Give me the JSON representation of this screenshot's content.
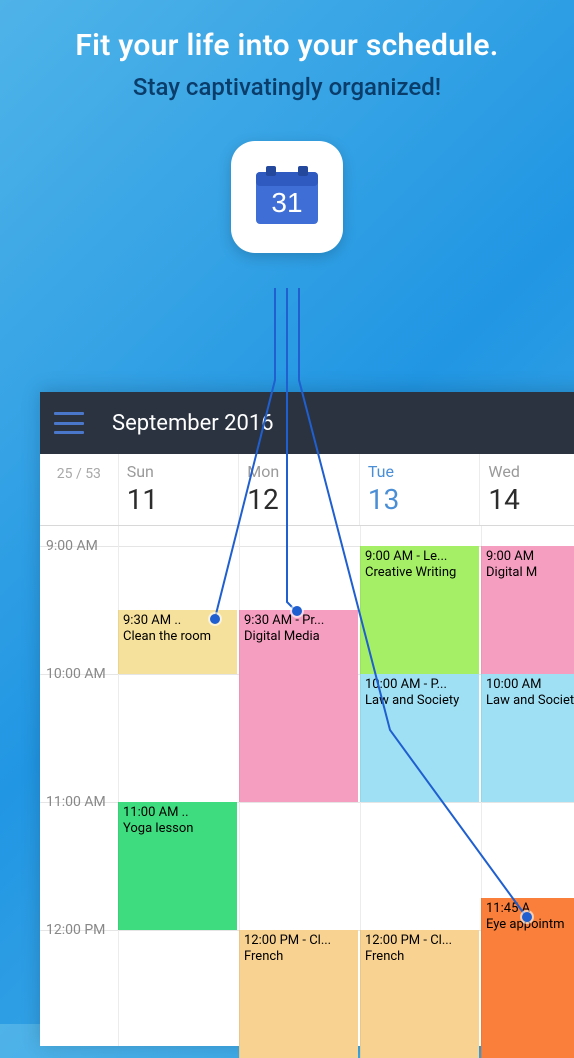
{
  "hero": {
    "title": "Fit your life into your schedule.",
    "subtitle": "Stay captivatingly organized!"
  },
  "app_icon": {
    "day_number": "31"
  },
  "calendar": {
    "header": {
      "title": "September 2016"
    },
    "week_label": "25 / 53",
    "days": [
      {
        "name": "Sun",
        "num": "11"
      },
      {
        "name": "Mon",
        "num": "12"
      },
      {
        "name": "Tue",
        "num": "13"
      },
      {
        "name": "Wed",
        "num": "14"
      }
    ],
    "hours": [
      "9:00 AM",
      "10:00 AM",
      "11:00 AM",
      "12:00 PM"
    ],
    "events": [
      {
        "col": 0,
        "start": 9.5,
        "end": 10.0,
        "time": "9:30 AM ..",
        "title": "Clean the room",
        "color": "#f5e19b"
      },
      {
        "col": 0,
        "start": 11.0,
        "end": 12.0,
        "time": "11:00 AM ..",
        "title": "Yoga lesson",
        "color": "#3edc7e"
      },
      {
        "col": 1,
        "start": 9.5,
        "end": 11.0,
        "time": "9:30 AM - Pr...",
        "title": "Digital Media",
        "color": "#f59ec0"
      },
      {
        "col": 1,
        "start": 12.0,
        "end": 13.0,
        "time": "12:00 PM - Cl...",
        "title": "French",
        "color": "#f7d291"
      },
      {
        "col": 2,
        "start": 9.0,
        "end": 10.0,
        "time": "9:00 AM - Le...",
        "title": "Creative Writing",
        "color": "#a4ef65"
      },
      {
        "col": 2,
        "start": 10.0,
        "end": 11.0,
        "time": "10:00 AM - P...",
        "title": "Law and Society",
        "color": "#9fe0f5"
      },
      {
        "col": 2,
        "start": 12.0,
        "end": 13.0,
        "time": "12:00 PM - Cl...",
        "title": "French",
        "color": "#f7d291"
      },
      {
        "col": 3,
        "start": 9.0,
        "end": 10.0,
        "time": "9:00 AM",
        "title": "Digital M",
        "color": "#f59ec0"
      },
      {
        "col": 3,
        "start": 10.0,
        "end": 11.0,
        "time": "10:00 AM",
        "title": "Law and Society",
        "color": "#9fe0f5"
      },
      {
        "col": 3,
        "start": 11.75,
        "end": 13.0,
        "time": "11:45 A",
        "title": "Eye appointm",
        "color": "#f97f3a"
      }
    ]
  },
  "layout": {
    "time_col_width": 78,
    "day_col_width": 121,
    "hour_height": 128,
    "grid_start_hour": 9
  }
}
